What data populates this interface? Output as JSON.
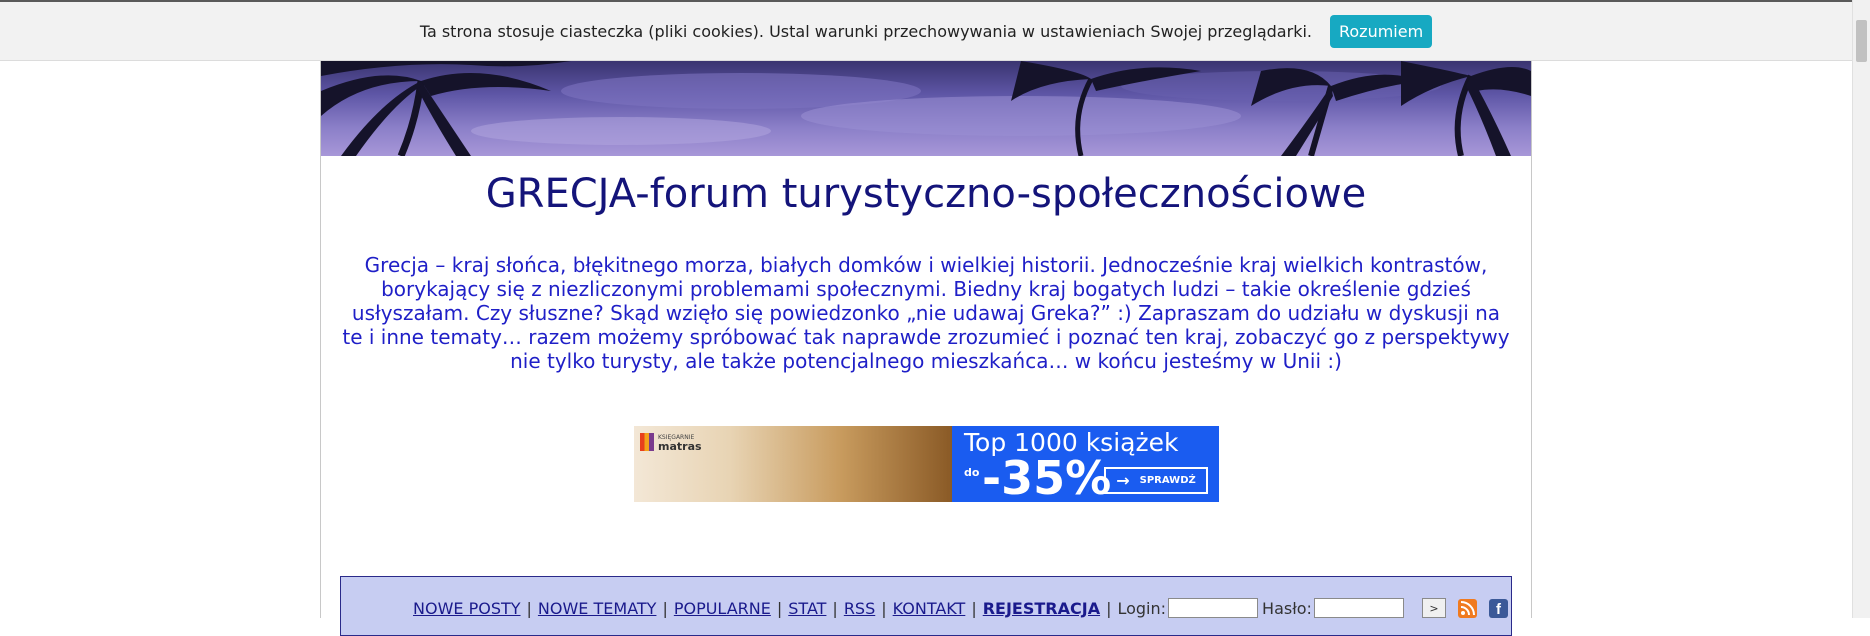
{
  "cookie_bar": {
    "message": "Ta strona stosuje ciasteczka (pliki cookies). Ustal warunki przechowywania w ustawieniach Swojej przeglądarki.",
    "accept_label": "Rozumiem"
  },
  "site": {
    "title": "GRECJA-forum turystyczno-społecznościowe",
    "intro": "Grecja – kraj słońca, błękitnego morza, białych domków i wielkiej historii. Jednocześnie kraj wielkich kontrastów, borykający się z niezliczonymi problemami społecznymi. Biedny kraj bogatych ludzi – takie określenie gdzieś usłyszałam. Czy słuszne? Skąd wzięło się powiedzonko „nie udawaj Greka?” :) Zapraszam do udziału w dyskusji na te i inne tematy… razem możemy spróbować tak naprawde zrozumieć i poznać ten kraj, zobaczyć go z perspektywy nie tylko turysty, ale także potencjalnego mieszkańca… w końcu jesteśmy w Unii :)"
  },
  "ad": {
    "logo_small": "KSIĘGARNIE",
    "logo_big": "matras",
    "headline": "Top 1000 książek",
    "prefix": "do",
    "discount": "-35%",
    "cta": "SPRAWDŹ"
  },
  "nav": {
    "items": [
      "NOWE POSTY",
      "NOWE TEMATY",
      "POPULARNE",
      "STAT",
      "RSS",
      "KONTAKT"
    ],
    "register": "REJESTRACJA",
    "login_label": "Login:",
    "password_label": "Hasło:",
    "go_label": ">"
  },
  "colors": {
    "cookie_button": "#17a9c2",
    "title": "#14147a",
    "intro": "#1f1fc7",
    "nav_bg": "#c7cdf2",
    "ad_blue": "#1a5cf0"
  }
}
